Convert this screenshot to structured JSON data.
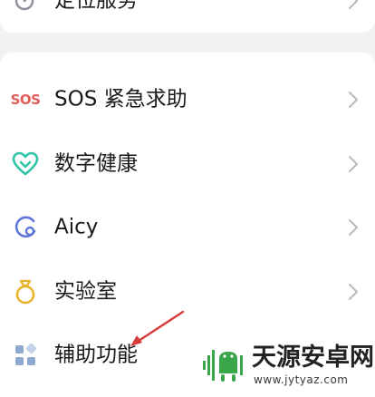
{
  "rows": [
    {
      "label": "定位服务",
      "icon": "location-icon"
    },
    {
      "label": "SOS 紧急求助",
      "icon": "sos-icon",
      "icon_text": "SOS"
    },
    {
      "label": "数字健康",
      "icon": "heart-icon"
    },
    {
      "label": "Aicy",
      "icon": "aicy-icon"
    },
    {
      "label": "实验室",
      "icon": "lab-ring-icon"
    },
    {
      "label": "辅助功能",
      "icon": "accessibility-grid-icon"
    }
  ],
  "watermark": {
    "title": "天源安卓网",
    "url": "www.jytyaz.com"
  },
  "colors": {
    "background": "#f2f2f4",
    "card": "#ffffff",
    "text": "#1a1a1a",
    "chevron": "#b9b9bd",
    "sos_red": "#e45d5a",
    "heart_teal": "#2ec4a8",
    "aicy_blue": "#6077d9",
    "lab_gold": "#e8b22c",
    "grid_blue": "#8ea9cf",
    "annotation_arrow": "#d63a3a",
    "watermark_green": "#3aa64a"
  }
}
